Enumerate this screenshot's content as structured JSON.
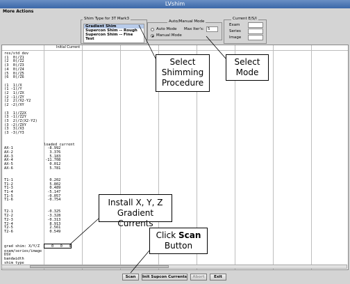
{
  "window": {
    "title": "LVshim"
  },
  "menu": {
    "more_actions": "More Actions"
  },
  "shim_type": {
    "title": "Shim Type for 3T Mark3",
    "items": [
      "Gradient Shim",
      "Supercon Shim -- Rough",
      "Supercon Shim -- Fine",
      "Test"
    ],
    "selected": "Gradient Shim"
  },
  "mode": {
    "title": "Auto/Manual Mode",
    "auto_label": "Auto Mode",
    "manual_label": "Manual Mode",
    "selected": "Manual Mode",
    "max_iter_label": "Max Iter's:",
    "max_iter_value": "5"
  },
  "current_esi": {
    "title": "Current E/S/I",
    "exam_label": "Exam",
    "series_label": "Series",
    "image_label": "Image",
    "exam_value": "",
    "series_value": "",
    "image_value": ""
  },
  "table": {
    "header": "Initial Current",
    "rows_block1": [
      "res/std dev",
      "(1  0)/Z1",
      "(2  0)/Z2",
      "(3  0)/Z3",
      "(4  0)/Z4",
      "(5  0)/Z5",
      "(6  0)/Z6"
    ],
    "rows_block2": [
      "(1  1)/X",
      "(1 -1)/Y",
      "(2  1)/ZX",
      "(2 -1)/ZY",
      "(2  2)/X2-Y2",
      "(2 -2)/XY"
    ],
    "rows_block3": [
      "(3  1)/Z2X",
      "(3 -1)/Z2Y",
      "(3  2)/Z(X2-Y2)",
      "(3 -2)/ZXY",
      "(3  3)/X3",
      "(3 -3)/Y3"
    ],
    "loaded_header": "loaded current",
    "ax": [
      {
        "name": "AX-1",
        "value": "-8.992"
      },
      {
        "name": "AX-2",
        "value": "3.376"
      },
      {
        "name": "AX-3",
        "value": "5.183"
      },
      {
        "name": "AX-4",
        "value": "-11.708"
      },
      {
        "name": "AX-5",
        "value": "0.012"
      },
      {
        "name": "AX-6",
        "value": "5.781"
      }
    ],
    "t1": [
      {
        "name": "T1-1",
        "value": "0.202"
      },
      {
        "name": "T1-2",
        "value": "5.802"
      },
      {
        "name": "T1-3",
        "value": "0.489"
      },
      {
        "name": "T1-4",
        "value": "-5.147"
      },
      {
        "name": "T1-5",
        "value": "-0.057"
      },
      {
        "name": "T1-6",
        "value": "-0.754"
      }
    ],
    "t2": [
      {
        "name": "T2-1",
        "value": "-0.325"
      },
      {
        "name": "T2-2",
        "value": "-3.328"
      },
      {
        "name": "T2-3",
        "value": "-0.313"
      },
      {
        "name": "T2-4",
        "value": "8.913"
      },
      {
        "name": "T2-5",
        "value": "2.561"
      },
      {
        "name": "T2-6",
        "value": "0.549"
      }
    ],
    "grad_shim_label": "grad shim: X/Y/Z",
    "grad_shim_values": "0   0   0",
    "footer_rows": [
      "exam/series/image",
      "DSV",
      "bandwidth",
      "shim type"
    ]
  },
  "buttons": {
    "scan": "Scan",
    "init_supcon": "Init Supcon Currents",
    "abort": "Abort",
    "exit": "Exit"
  },
  "callouts": {
    "select_shimming_procedure": [
      "Select",
      "Shimming",
      "Procedure"
    ],
    "select_mode": [
      "Select",
      "Mode"
    ],
    "install_gradient_currents": [
      "Install X, Y, Z",
      "Gradient Currents"
    ],
    "click_scan_prefix": "Click ",
    "click_scan_bold": "Scan",
    "click_scan_line2": "Button"
  }
}
